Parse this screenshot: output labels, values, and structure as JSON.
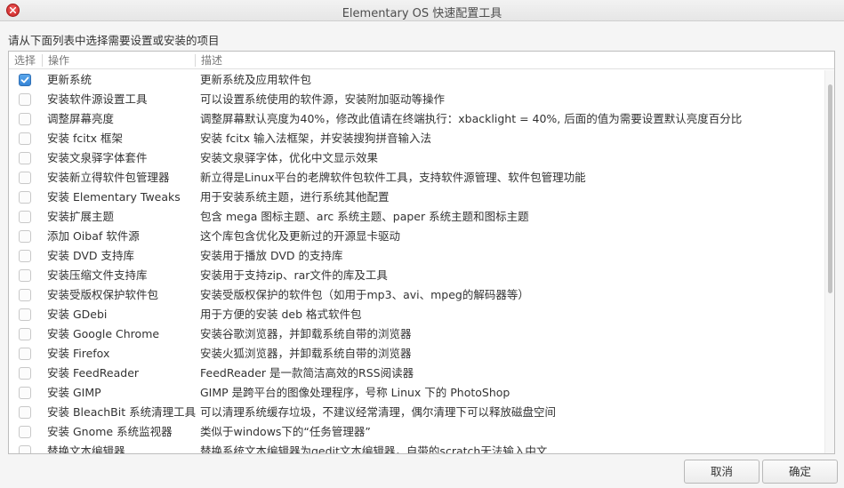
{
  "window": {
    "title": "Elementary OS 快速配置工具"
  },
  "prompt": "请从下面列表中选择需要设置或安装的项目",
  "columns": {
    "select": "选择",
    "action": "操作",
    "description": "描述"
  },
  "items": [
    {
      "name": "更新系统",
      "desc": "更新系统及应用软件包",
      "checked": true
    },
    {
      "name": "安装软件源设置工具",
      "desc": "可以设置系统使用的软件源，安装附加驱动等操作",
      "checked": false
    },
    {
      "name": "调整屏幕亮度",
      "desc": "调整屏幕默认亮度为40%，修改此值请在终端执行：xbacklight = 40%, 后面的值为需要设置默认亮度百分比",
      "checked": false
    },
    {
      "name": "安装 fcitx 框架",
      "desc": "安装 fcitx 输入法框架，并安装搜狗拼音输入法",
      "checked": false
    },
    {
      "name": "安装文泉驿字体套件",
      "desc": "安装文泉驿字体，优化中文显示效果",
      "checked": false
    },
    {
      "name": "安装新立得软件包管理器",
      "desc": "新立得是Linux平台的老牌软件包软件工具，支持软件源管理、软件包管理功能",
      "checked": false
    },
    {
      "name": "安装 Elementary Tweaks",
      "desc": "用于安装系统主题，进行系统其他配置",
      "checked": false
    },
    {
      "name": "安装扩展主题",
      "desc": "包含 mega 图标主题、arc 系统主题、paper 系统主题和图标主题",
      "checked": false
    },
    {
      "name": "添加 Oibaf 软件源",
      "desc": "这个库包含优化及更新过的开源显卡驱动",
      "checked": false
    },
    {
      "name": "安装 DVD 支持库",
      "desc": "安装用于播放 DVD 的支持库",
      "checked": false
    },
    {
      "name": "安装压缩文件支持库",
      "desc": "安装用于支持zip、rar文件的库及工具",
      "checked": false
    },
    {
      "name": "安装受版权保护软件包",
      "desc": "安装受版权保护的软件包（如用于mp3、avi、mpeg的解码器等）",
      "checked": false
    },
    {
      "name": "安装 GDebi",
      "desc": "用于方便的安装 deb 格式软件包",
      "checked": false
    },
    {
      "name": "安装 Google Chrome",
      "desc": "安装谷歌浏览器，并卸载系统自带的浏览器",
      "checked": false
    },
    {
      "name": "安装 Firefox",
      "desc": "安装火狐浏览器，并卸载系统自带的浏览器",
      "checked": false
    },
    {
      "name": "安装 FeedReader",
      "desc": "FeedReader 是一款简洁高效的RSS阅读器",
      "checked": false
    },
    {
      "name": "安装 GIMP",
      "desc": "GIMP 是跨平台的图像处理程序，号称 Linux 下的 PhotoShop",
      "checked": false
    },
    {
      "name": "安装 BleachBit 系统清理工具",
      "desc": "可以清理系统缓存垃圾，不建议经常清理，偶尔清理下可以释放磁盘空间",
      "checked": false
    },
    {
      "name": "安装 Gnome 系统监视器",
      "desc": "类似于windows下的“任务管理器”",
      "checked": false
    },
    {
      "name": "替换文本编辑器",
      "desc": "替换系统文本编辑器为gedit文本编辑器，自带的scratch无法输入中文",
      "checked": false
    }
  ],
  "buttons": {
    "cancel": "取消",
    "ok": "确定"
  },
  "icons": {
    "close": "close-icon",
    "check": "checkmark-icon"
  },
  "colors": {
    "accent": "#3584d6",
    "close": "#d93a3a"
  }
}
